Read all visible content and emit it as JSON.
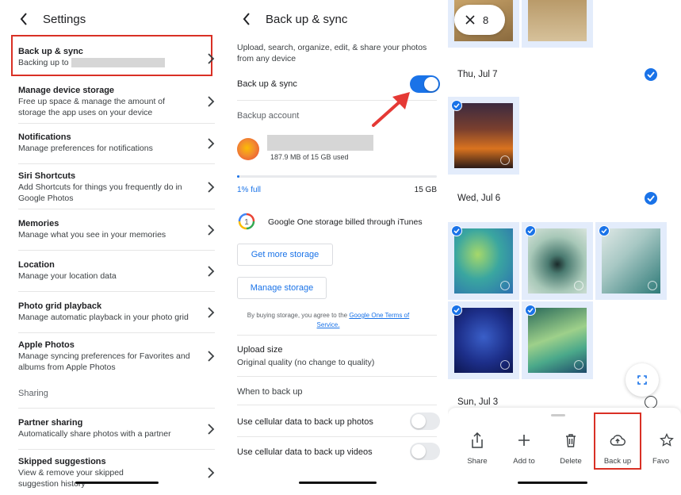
{
  "settings": {
    "title": "Settings",
    "items": [
      {
        "title": "Back up & sync",
        "subtitle": "Backing up to"
      },
      {
        "title": "Manage device storage",
        "subtitle": "Free up space & manage the amount of storage the app uses on your device"
      },
      {
        "title": "Notifications",
        "subtitle": "Manage preferences for notifications"
      },
      {
        "title": "Siri Shortcuts",
        "subtitle": "Add Shortcuts for things you frequently do in Google Photos"
      },
      {
        "title": "Memories",
        "subtitle": "Manage what you see in your memories"
      },
      {
        "title": "Location",
        "subtitle": "Manage your location data"
      },
      {
        "title": "Photo grid playback",
        "subtitle": "Manage automatic playback in your photo grid"
      },
      {
        "title": "Apple Photos",
        "subtitle": "Manage syncing preferences for Favorites and albums from Apple Photos"
      },
      {
        "title": "Sharing",
        "subtitle": ""
      },
      {
        "title": "Partner sharing",
        "subtitle": "Automatically share photos with a partner"
      },
      {
        "title": "Skipped suggestions",
        "subtitle": "View & remove your skipped suggestion history"
      }
    ]
  },
  "backup": {
    "title": "Back up & sync",
    "intro": "Upload, search, organize, edit, & share your photos from any device",
    "toggle_label": "Back up & sync",
    "toggle_on": true,
    "account_label": "Backup account",
    "usage": "187.9 MB of 15 GB used",
    "percent_full": "1% full",
    "total": "15 GB",
    "storage_fraction": 0.01,
    "google_one": "Google One storage billed through iTunes",
    "get_more": "Get more storage",
    "manage": "Manage storage",
    "terms_prefix": "By buying storage, you agree to the",
    "terms_link": "Google One Terms of Service.",
    "upload_size_label": "Upload size",
    "upload_size_value": "Original quality (no change to quality)",
    "when_label": "When to back up",
    "cell_photos": "Use cellular data to back up photos",
    "cell_videos": "Use cellular data to back up videos"
  },
  "photos": {
    "selected_count": "8",
    "dates": [
      "Thu, Jul 7",
      "Wed, Jul 6",
      "Sun, Jul 3"
    ],
    "actions": [
      "Share",
      "Add to",
      "Delete",
      "Back up",
      "Favo"
    ]
  },
  "colors": {
    "accent": "#1a73e8",
    "highlight": "#d93025",
    "arrow": "#e53935"
  }
}
